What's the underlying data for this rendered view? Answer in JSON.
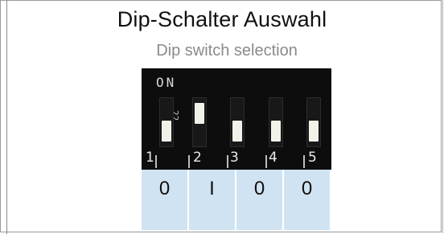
{
  "title": "Dip-Schalter Auswahl",
  "subtitle": "Dip switch selection",
  "switch": {
    "on_label": "ON",
    "side_marking": "22",
    "positions": [
      "1",
      "2",
      "3",
      "4",
      "5"
    ]
  },
  "values": [
    "0",
    "I",
    "0",
    "0"
  ]
}
